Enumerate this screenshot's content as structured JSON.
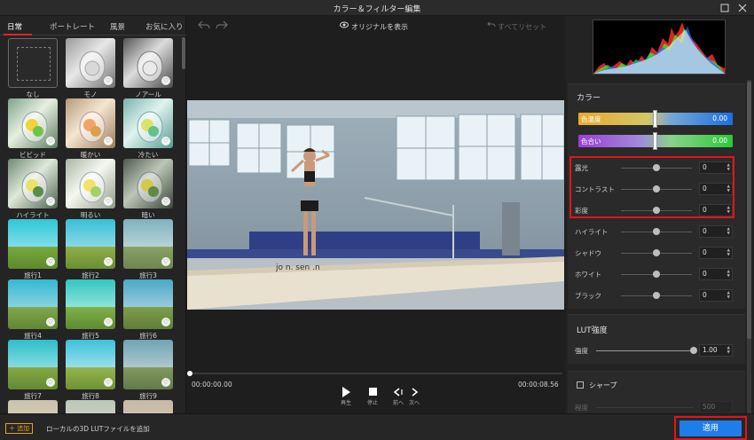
{
  "window": {
    "title": "カラー＆フィルター編集"
  },
  "tabs": [
    {
      "label": "日常"
    },
    {
      "label": "ポートレート"
    },
    {
      "label": "風景"
    },
    {
      "label": "お気に入り"
    }
  ],
  "filters": [
    {
      "label": "なし"
    },
    {
      "label": "モノ"
    },
    {
      "label": "ノアール"
    },
    {
      "label": "ビビッド"
    },
    {
      "label": "暖かい"
    },
    {
      "label": "冷たい"
    },
    {
      "label": "ハイライト"
    },
    {
      "label": "明るい"
    },
    {
      "label": "暗い"
    },
    {
      "label": "旅行1"
    },
    {
      "label": "旅行2"
    },
    {
      "label": "旅行3"
    },
    {
      "label": "旅行4"
    },
    {
      "label": "旅行5"
    },
    {
      "label": "旅行6"
    },
    {
      "label": "旅行7"
    },
    {
      "label": "旅行8"
    },
    {
      "label": "旅行9"
    }
  ],
  "preview": {
    "show_original": "オリジナルを表示",
    "reset_all": "すべてリセット",
    "time_current": "00:00:00.00",
    "time_total": "00:00:08.56",
    "watermark": "jo n. sen .n",
    "controls": [
      {
        "icon": "play-icon",
        "label": "再生"
      },
      {
        "icon": "stop-icon",
        "label": "停止"
      },
      {
        "icon": "prev-frame-icon",
        "label": "前へ"
      },
      {
        "icon": "next-frame-icon",
        "label": "次へ"
      }
    ]
  },
  "color": {
    "title": "カラー",
    "temperature": {
      "label": "色温度",
      "value": "0.00"
    },
    "tint": {
      "label": "色合い",
      "value": "0.00"
    },
    "sliders": [
      {
        "label": "露光",
        "value": "0"
      },
      {
        "label": "コントラスト",
        "value": "0"
      },
      {
        "label": "彩度",
        "value": "0"
      },
      {
        "label": "ハイライト",
        "value": "0"
      },
      {
        "label": "シャドウ",
        "value": "0"
      },
      {
        "label": "ホワイト",
        "value": "0"
      },
      {
        "label": "ブラック",
        "value": "0"
      }
    ]
  },
  "lut": {
    "title": "LUT強度",
    "strength_label": "強度",
    "strength_value": "1.00"
  },
  "sharpen": {
    "label": "シャープ",
    "sub_label": "程度",
    "sub_value": "500"
  },
  "bottom": {
    "add_label": "＋ 追加",
    "add_hint": "ローカルの3D LUTファイルを追加",
    "apply_label": "適用"
  },
  "colors": {
    "accent_blue": "#1f7de8",
    "highlight_red": "#e4131b",
    "add_orange": "#e6a11d",
    "tab_red": "#e0242a"
  }
}
